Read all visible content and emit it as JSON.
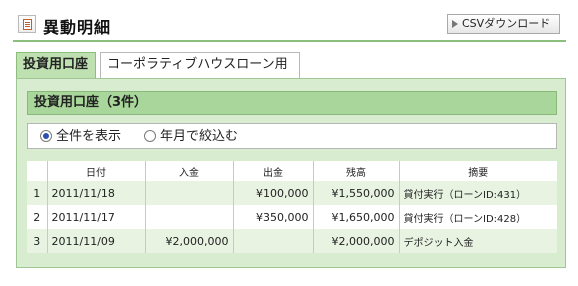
{
  "header": {
    "title": "異動明細",
    "csv_button": "CSVダウンロード"
  },
  "tabs": [
    {
      "label": "投資用口座",
      "active": true
    },
    {
      "label": "コーポラティブハウスローン用口座",
      "active": false
    }
  ],
  "panel": {
    "title": "投資用口座（3件）",
    "filters": [
      {
        "label": "全件を表示",
        "selected": true
      },
      {
        "label": "年月で絞込む",
        "selected": false
      }
    ]
  },
  "table": {
    "headers": [
      "",
      "日付",
      "入金",
      "出金",
      "残高",
      "摘要"
    ],
    "rows": [
      {
        "no": "1",
        "date": "2011/11/18",
        "deposit": "",
        "withdrawal": "¥100,000",
        "balance": "¥1,550,000",
        "memo": "貸付実行（ローンID:431）"
      },
      {
        "no": "2",
        "date": "2011/11/17",
        "deposit": "",
        "withdrawal": "¥350,000",
        "balance": "¥1,650,000",
        "memo": "貸付実行（ローンID:428）"
      },
      {
        "no": "3",
        "date": "2011/11/09",
        "deposit": "¥2,000,000",
        "withdrawal": "",
        "balance": "¥2,000,000",
        "memo": "デポジット入金"
      }
    ]
  },
  "colors": {
    "accent_green": "#a9d79b",
    "panel_bg": "#d8ecd0",
    "row_alt": "#e8f3e2"
  }
}
